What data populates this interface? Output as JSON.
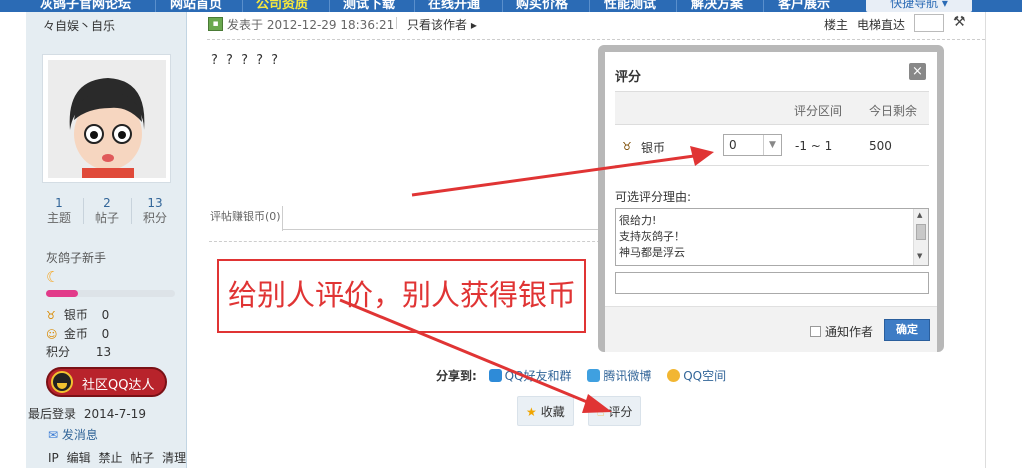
{
  "topnav": {
    "items": [
      {
        "label": "灰鸽子官网论坛",
        "active": false
      },
      {
        "label": "网站首页",
        "active": false
      },
      {
        "label": "公司资质",
        "active": true
      },
      {
        "label": "测试下载",
        "active": false
      },
      {
        "label": "在线开通",
        "active": false
      },
      {
        "label": "购买价格",
        "active": false
      },
      {
        "label": "性能测试",
        "active": false
      },
      {
        "label": "解决方案",
        "active": false
      },
      {
        "label": "客户展示",
        "active": false
      }
    ],
    "quicknav": "快捷导航 ▾"
  },
  "user": {
    "name": "々自娱丶自乐",
    "stats": [
      {
        "value": "1",
        "label": "主题"
      },
      {
        "value": "2",
        "label": "帖子"
      },
      {
        "value": "13",
        "label": "积分"
      }
    ],
    "rank": "灰鸽子新手",
    "progress": 0.25,
    "credits": [
      {
        "label": "银币",
        "value": "0",
        "icon": "silver-coin-icon"
      },
      {
        "label": "金币",
        "value": "0",
        "icon": "gold-coin-icon"
      },
      {
        "label": "积分",
        "value": "13",
        "icon": ""
      }
    ],
    "qq_badge": "社区QQ达人",
    "last_login_label": "最后登录",
    "last_login": "2014-7-19",
    "send_message": "发消息",
    "admin_links": [
      "IP",
      "编辑",
      "禁止",
      "帖子",
      "清理"
    ]
  },
  "post": {
    "posted_at": "发表于 2012-12-29 18:36:21",
    "only_author": "只看该作者 ▸",
    "floor": "楼主",
    "elevator": "电梯直达",
    "content": "? ? ? ? ?",
    "rate_tab": "评帖赚银币(0)"
  },
  "annotation": {
    "text": "给别人评价，别人获得银币",
    "color": "#e03434"
  },
  "share": {
    "label": "分享到:",
    "links": [
      "QQ好友和群",
      "腾讯微博",
      "QQ空间"
    ]
  },
  "actions": {
    "favorite": "收藏",
    "rate": "评分"
  },
  "dialog": {
    "title": "评分",
    "close": "×",
    "col_range": "评分区间",
    "col_remaining": "今日剩余",
    "currency": "银币",
    "score_value": "0",
    "range": "-1 ~ 1",
    "remaining": "500",
    "reason_label": "可选评分理由:",
    "reasons": [
      "很给力!",
      "支持灰鸽子！",
      "神马都是浮云"
    ],
    "notify_label": "通知作者",
    "confirm": "确定"
  }
}
